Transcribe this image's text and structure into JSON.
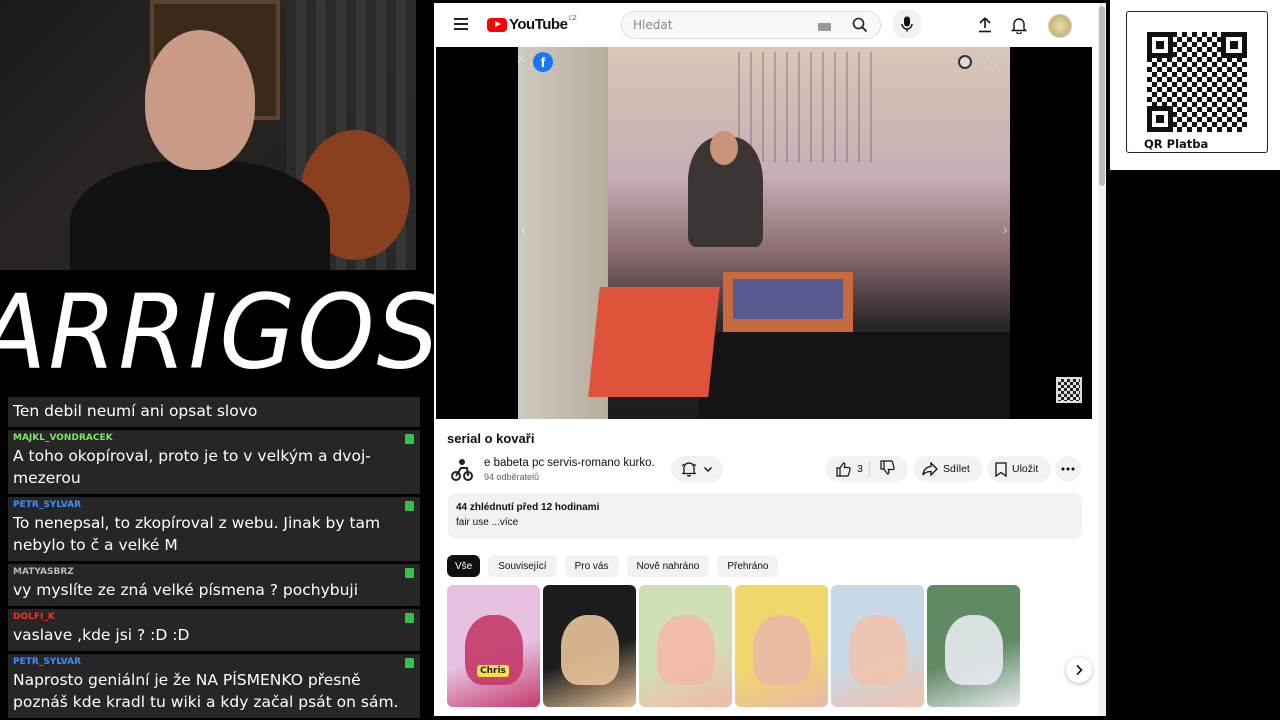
{
  "stream": {
    "logo_text": "ARRIGOS",
    "qr_label": "QR Platba"
  },
  "chat": {
    "messages": [
      {
        "user": "",
        "text": "Ten debil neumí ani opsat slovo",
        "user_color": "#ffffff"
      },
      {
        "user": "MAJKL_VONDRACEK",
        "text": "A toho okopíroval, proto je to v velkým a dvoj-mezerou",
        "user_color": "#7fe36a"
      },
      {
        "user": "PETR_SYLVAR",
        "text": "To nenepsal, to zkopíroval z webu. Jinak by tam nebylo to č a velké M",
        "user_color": "#3f8cff"
      },
      {
        "user": "MATYASBRZ",
        "text": "vy myslíte ze zná velké písmena ? pochybuji",
        "user_color": "#b9b9b9"
      },
      {
        "user": "DOLFI_K",
        "text": "vaslave ,kde jsi ? :D :D",
        "user_color": "#ff2a2a"
      },
      {
        "user": "PETR_SYLVAR",
        "text": "Naprosto geniální je že NA PÍSMENKO přesně poznáš kde kradl tu wiki a kdy začal psát on sám.",
        "user_color": "#3f8cff"
      }
    ]
  },
  "youtube": {
    "logo": "YouTube",
    "country": "CZ",
    "search_placeholder": "Hledat",
    "video": {
      "title": "serial o kovaři",
      "channel": "e babeta pc servis-romano kurko.",
      "subscribers": "94 odběratelů",
      "likes": "3",
      "share": "Sdílet",
      "save": "Uložit",
      "meta": "44 zhlédnutí  před 12 hodinami",
      "description": "fair use ...více"
    },
    "chips": [
      "Vše",
      "Související",
      "Pro vás",
      "Nově nahráno",
      "Přehráno"
    ],
    "thumbnails": [
      {
        "color": "#e7c1e0",
        "accent": "#c43a6b",
        "label": "Chris"
      },
      {
        "color": "#1c1c1c",
        "accent": "#e8c39a",
        "label": ""
      },
      {
        "color": "#cfe0b4",
        "accent": "#f2b9a8",
        "label": ""
      },
      {
        "color": "#f0d76c",
        "accent": "#eab9a6",
        "label": ""
      },
      {
        "color": "#c7d8e6",
        "accent": "#f1c2ad",
        "label": ""
      },
      {
        "color": "#5f8a63",
        "accent": "#e7e9ef",
        "label": ""
      }
    ]
  }
}
